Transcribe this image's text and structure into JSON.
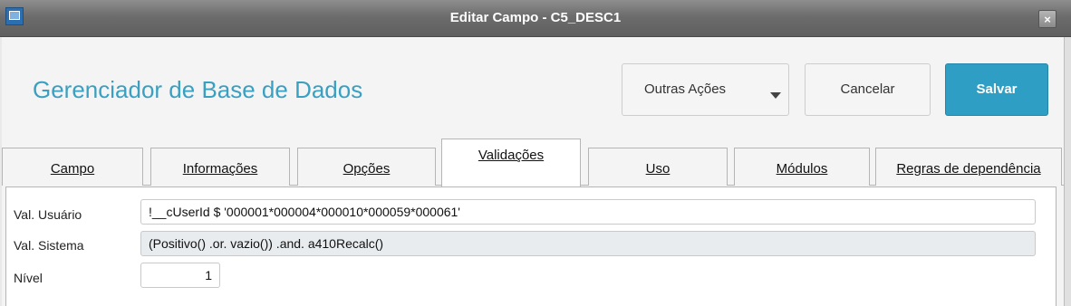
{
  "window": {
    "title": "Editar Campo - C5_DESC1",
    "close": "×"
  },
  "header": {
    "title": "Gerenciador de Base de Dados"
  },
  "actions": {
    "outras": "Outras Ações",
    "cancel": "Cancelar",
    "save": "Salvar"
  },
  "tabs": [
    {
      "label": "Campo"
    },
    {
      "label": "Informações"
    },
    {
      "label": "Opções"
    },
    {
      "label": "Validações",
      "active": true
    },
    {
      "label": "Uso"
    },
    {
      "label": "Módulos"
    },
    {
      "label": "Regras de dependência"
    }
  ],
  "form": {
    "val_usuario": {
      "label": "Val. Usuário",
      "value": "!__cUserId $ '000001*000004*000010*000059*000061'"
    },
    "val_sistema": {
      "label": "Val. Sistema",
      "value": "(Positivo() .or. vazio()) .and. a410Recalc()"
    },
    "nivel": {
      "label": "Nível",
      "value": "1"
    }
  },
  "colors": {
    "accent": "#3aa0c2",
    "primary_button": "#2e9ec4",
    "titlebar": "#6c6c6c"
  }
}
